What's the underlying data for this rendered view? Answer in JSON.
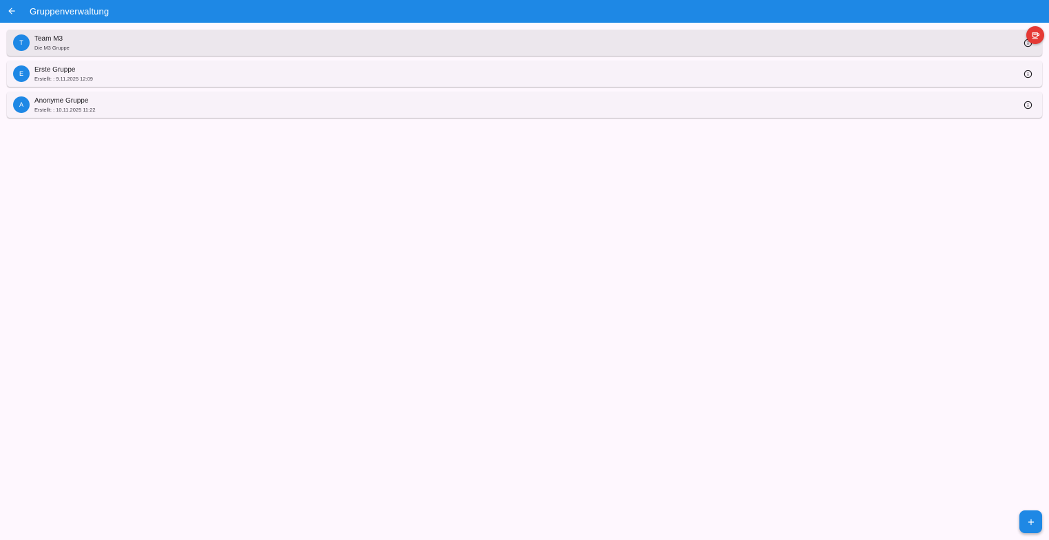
{
  "appbar": {
    "title": "Gruppenverwaltung",
    "back_icon": "arrow-back-icon",
    "color": "#1e88e5"
  },
  "groups": [
    {
      "initial": "T",
      "name": "Team M3",
      "subtitle": "Die M3 Gruppe",
      "selected": true
    },
    {
      "initial": "E",
      "name": "Erste Gruppe",
      "subtitle": "Erstellt: : 9.11.2025 12:09",
      "selected": false
    },
    {
      "initial": "A",
      "name": "Anonyme Gruppe",
      "subtitle": "Erstellt: : 10.11.2025 11:22",
      "selected": false
    }
  ],
  "icons": {
    "info": "info-outline-icon",
    "badge": "coffee-icon",
    "fab": "add-icon"
  },
  "colors": {
    "primary": "#1e88e5",
    "badge": "#e53935",
    "background": "#fef7fe"
  }
}
